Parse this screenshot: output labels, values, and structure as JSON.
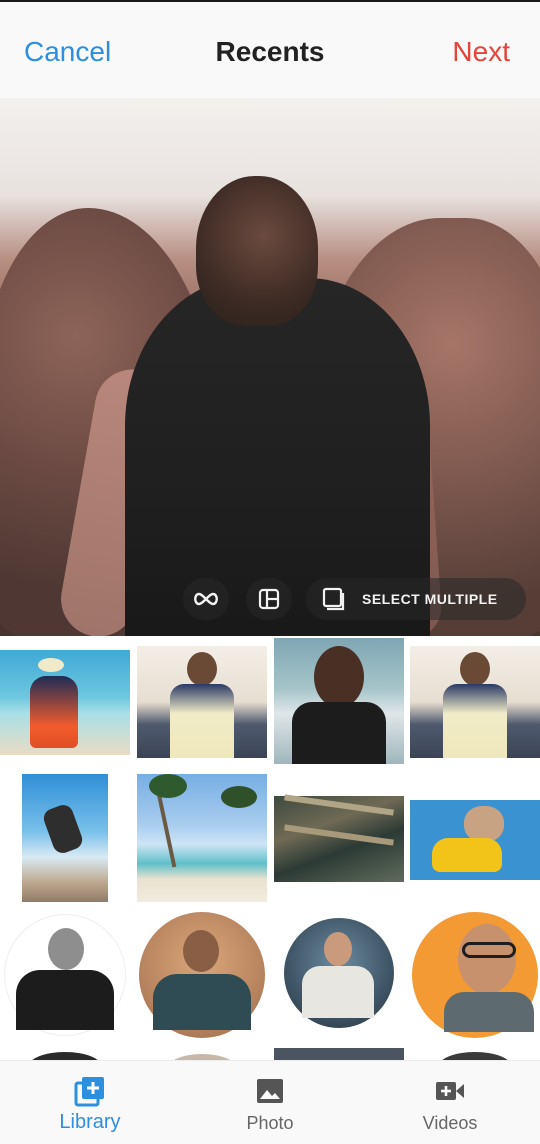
{
  "header": {
    "cancel_label": "Cancel",
    "title": "Recents",
    "next_label": "Next"
  },
  "preview": {
    "select_multiple_label": "SELECT MULTIPLE",
    "controls": [
      "infinity-icon",
      "layout-icon",
      "multi-select-icon"
    ]
  },
  "gallery": {
    "rows": [
      [
        "woman-beach-drink",
        "woman-apron-kitchen",
        "man-smiling-cafe",
        "woman-apron-kitchen"
      ],
      [
        "man-skateboarding",
        "palm-trees-beach",
        "seaweed-farm",
        "french-bulldog-yellow"
      ],
      [
        "bald-man-thumbs-up",
        "man-seated-smiling",
        "woman-chef-mixing",
        "man-glasses-orange"
      ]
    ]
  },
  "tabs": [
    {
      "label": "Library",
      "icon": "add-library-icon",
      "active": true
    },
    {
      "label": "Photo",
      "icon": "image-icon",
      "active": false
    },
    {
      "label": "Videos",
      "icon": "video-add-icon",
      "active": false
    }
  ],
  "colors": {
    "accent_blue": "#2d8fe0",
    "next_red": "#e6433a",
    "bar_bg": "#f9f9f9"
  }
}
